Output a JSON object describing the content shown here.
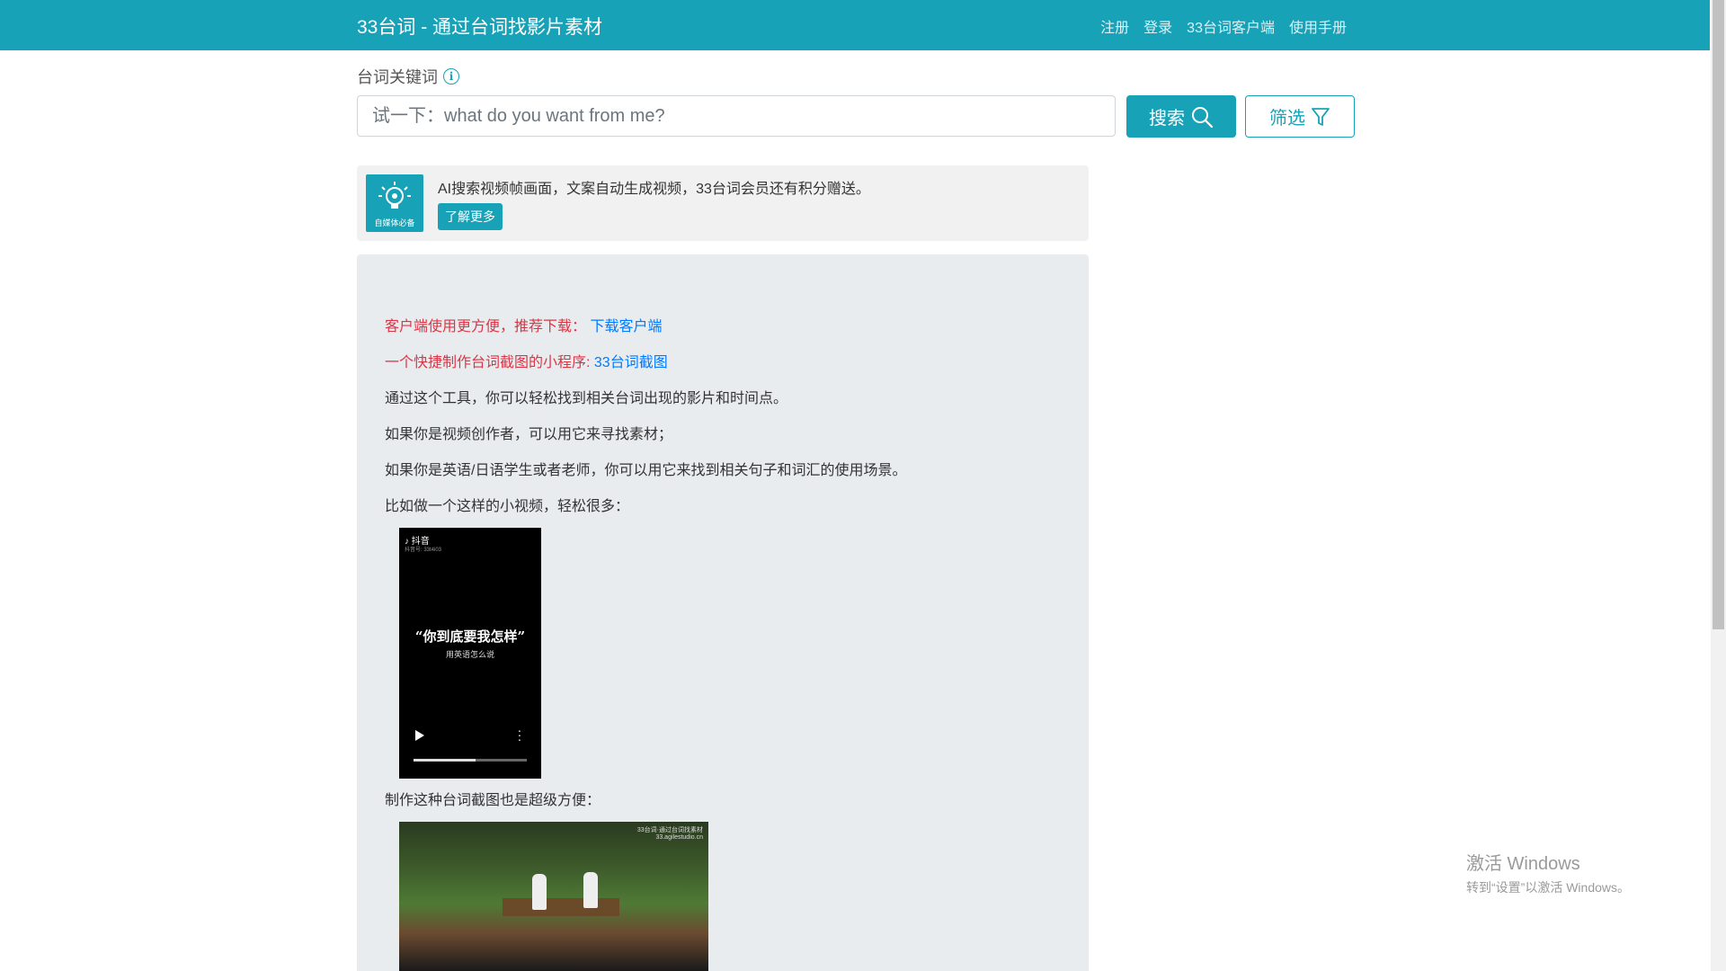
{
  "navbar": {
    "brand": "33台词 - 通过台词找影片素材",
    "links": [
      "注册",
      "登录",
      "33台词客户端",
      "使用手册"
    ]
  },
  "search": {
    "label": "台词关键词",
    "info_icon": "info-icon",
    "placeholder": "试一下：what do you want from me?",
    "search_button": "搜索",
    "filter_button": "筛选"
  },
  "promo": {
    "logo_text": "自媒体必备",
    "text": "AI搜索视频帧画面，文案自动生成视频，33台词会员还有积分赠送。",
    "button": "了解更多"
  },
  "panel": {
    "client_prefix": "客户端使用更方便，推荐下载：",
    "client_link": "下载客户端",
    "mini_prefix": "一个快捷制作台词截图的小程序:",
    "mini_link": "33台词截图",
    "p1": "通过这个工具，你可以轻松找到相关台词出现的影片和时间点。",
    "p2": "如果你是视频创作者，可以用它来寻找素材；",
    "p3": "如果你是英语/日语学生或者老师，你可以用它来找到相关句子和词汇的使用场景。",
    "p4": "比如做一个这样的小视频，轻松很多：",
    "p5": "制作这种台词截图也是超级方便："
  },
  "video": {
    "app_name": "抖音",
    "account": "抖音号: 33t4i03",
    "title": "“你到底要我怎样”",
    "caption": "用英语怎么说",
    "progress": 0.55
  },
  "screenshot": {
    "watermark": "33台词·通过台词找素材\n33.agilestudio.cn"
  },
  "windows_activation": {
    "title": "激活 Windows",
    "subtitle": "转到“设置”以激活 Windows。"
  },
  "colors": {
    "accent": "#17a2b8",
    "link": "#007bff",
    "red": "#dc3545"
  }
}
